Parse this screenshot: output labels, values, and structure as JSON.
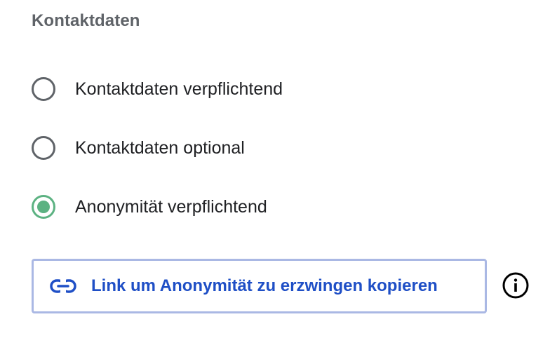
{
  "section": {
    "title": "Kontaktdaten"
  },
  "options": [
    {
      "label": "Kontaktdaten verpflichtend",
      "selected": false
    },
    {
      "label": "Kontaktdaten optional",
      "selected": false
    },
    {
      "label": "Anonymität verpflichtend",
      "selected": true
    }
  ],
  "copy_link_button": {
    "label": "Link um Anonymität zu erzwingen kopieren",
    "icon": "link-icon"
  },
  "info": {
    "icon": "info-icon"
  },
  "colors": {
    "accent_green": "#5cb282",
    "link_blue": "#1f4fc6",
    "button_border": "#aab8e4",
    "radio_border": "#5f6368"
  }
}
